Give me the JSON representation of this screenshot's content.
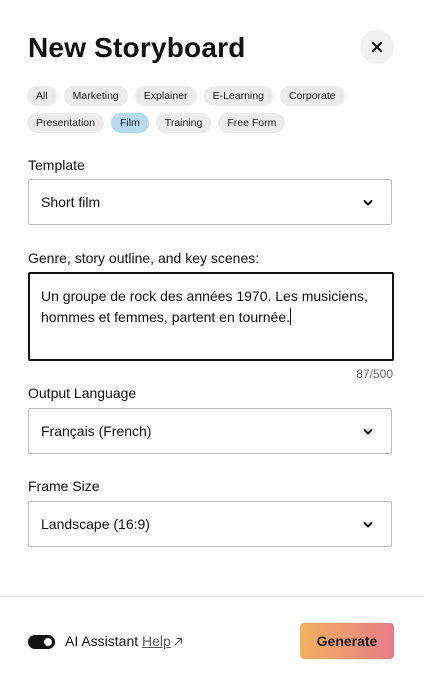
{
  "header": {
    "title": "New Storyboard"
  },
  "categories": {
    "row1": [
      "All",
      "Marketing",
      "Explainer",
      "E-Learning",
      "Corporate"
    ],
    "row2": [
      "Presentation",
      "Film",
      "Training",
      "Free Form"
    ],
    "selected": "Film"
  },
  "template": {
    "label": "Template",
    "value": "Short film"
  },
  "outline": {
    "label": "Genre, story outline, and key scenes:",
    "value": "Un groupe de rock des années 1970. Les musiciens, hommes et femmes, partent en tournée.",
    "counter": "87/500"
  },
  "language": {
    "label": "Output Language",
    "value": "Français (French)"
  },
  "frame": {
    "label": "Frame Size",
    "value": "Landscape (16:9)"
  },
  "footer": {
    "ai_label": "AI Assistant",
    "help_label": "Help",
    "ai_enabled": true,
    "generate_label": "Generate"
  },
  "colors": {
    "chip_selected": "#b5daf2",
    "chip_default": "#ececec",
    "generate_gradient_start": "#f2b15e",
    "generate_gradient_end": "#e77c89"
  },
  "icons": {
    "close": "close-icon",
    "chevron": "chevron-down-icon",
    "external": "external-link-icon"
  }
}
